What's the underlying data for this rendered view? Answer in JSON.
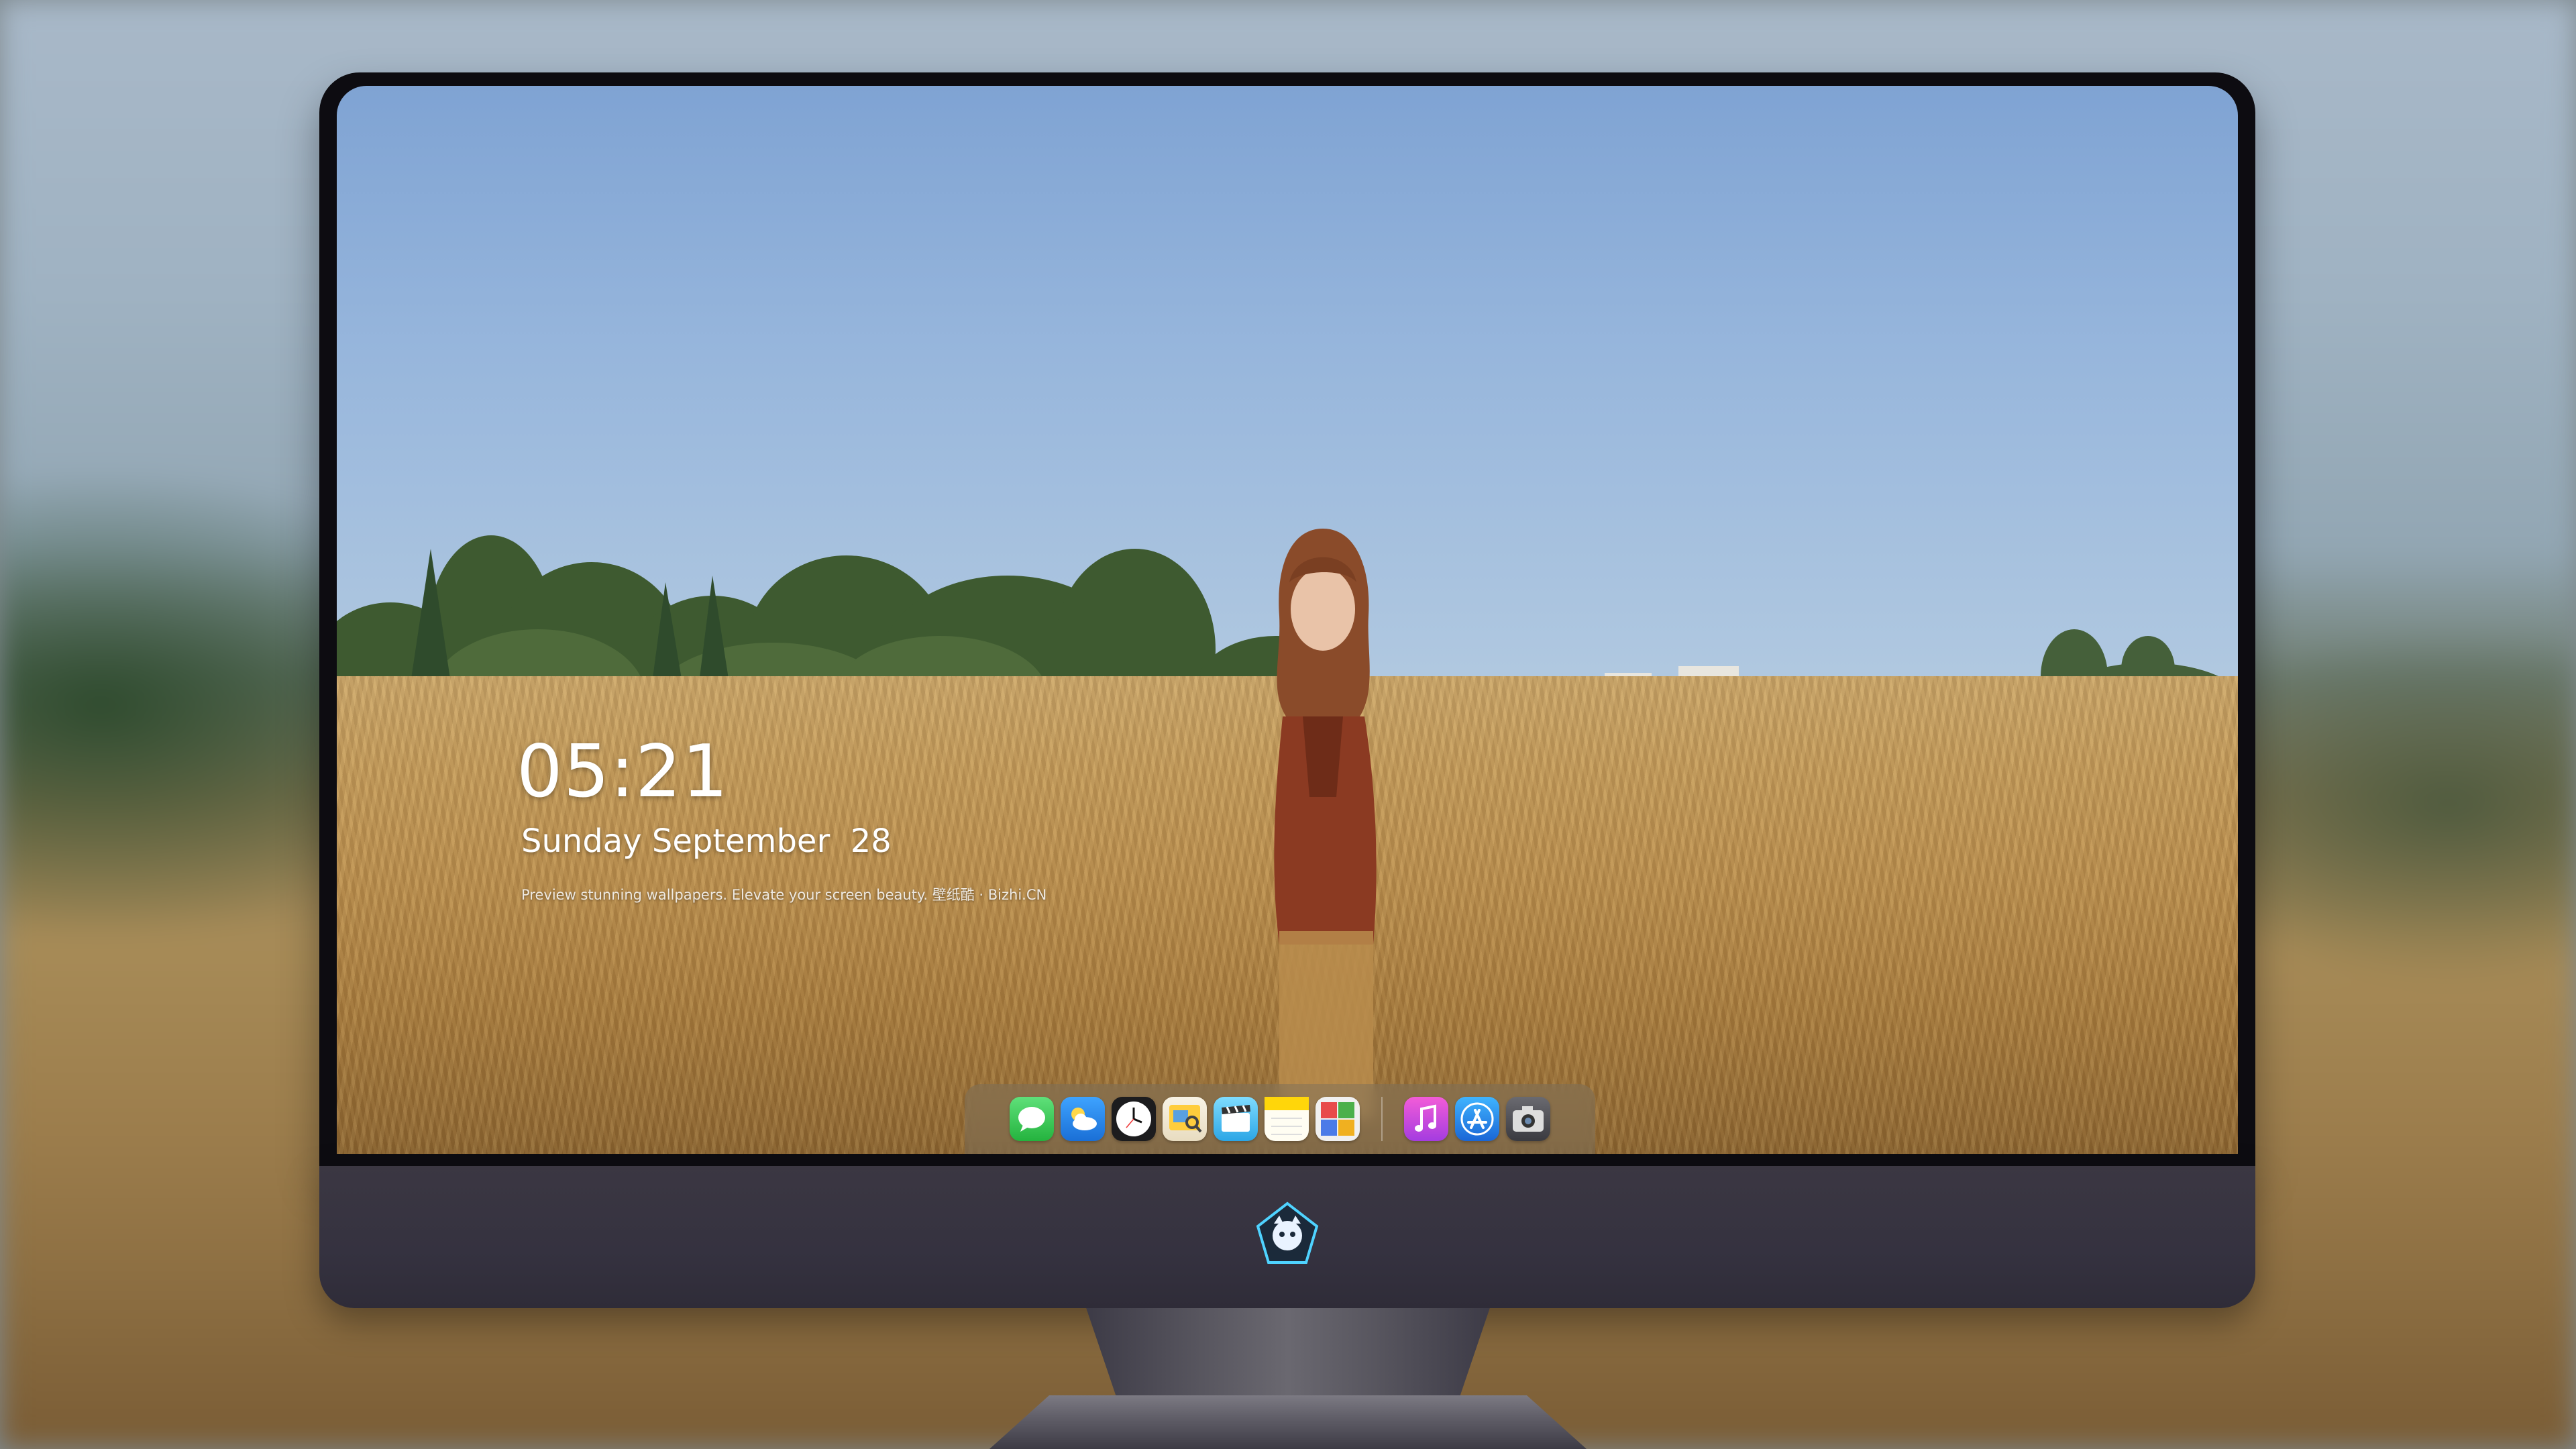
{
  "lockscreen": {
    "time": "05:21",
    "date": "Sunday September  28",
    "caption": "Preview stunning wallpapers. Elevate your screen beauty. 壁纸酷 · Bizhi.CN"
  },
  "dock": {
    "apps": [
      {
        "name": "messages-icon",
        "color": "#34c759"
      },
      {
        "name": "weather-icon",
        "color": "#2d8cf0"
      },
      {
        "name": "clock-icon",
        "color": "#1c1c1e"
      },
      {
        "name": "preview-icon",
        "color": "#f4b400"
      },
      {
        "name": "clips-icon",
        "color": "#5ac8fa"
      },
      {
        "name": "notes-icon",
        "color": "#ffd60a"
      },
      {
        "name": "photo-booth-icon",
        "color": "#e0e0e0"
      },
      {
        "name": "music-icon",
        "color": "#c646e8"
      },
      {
        "name": "app-store-icon",
        "color": "#1e88e5"
      },
      {
        "name": "camera-icon",
        "color": "#5a5a60"
      }
    ]
  },
  "monitor": {
    "logo": "mascot-logo-icon"
  }
}
